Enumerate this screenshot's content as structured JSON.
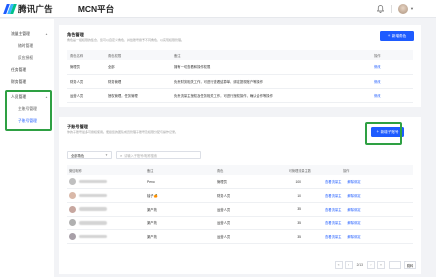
{
  "brand": {
    "name": "腾讯广告",
    "platform": "MCN平台",
    "colors": [
      "#1e5bff",
      "#3bb3ff",
      "#00c28a"
    ]
  },
  "sidebar": {
    "items": [
      {
        "label": "流量主管理",
        "type": "parent",
        "icon": "chevron-up-icon"
      },
      {
        "label": "随时管理",
        "type": "sub"
      },
      {
        "label": "反应授权",
        "type": "sub"
      },
      {
        "label": "任务管理",
        "type": "item"
      },
      {
        "label": "财务管理",
        "type": "item"
      },
      {
        "label": "人员管理",
        "type": "parent",
        "icon": "chevron-up-icon"
      },
      {
        "label": "主账号管理",
        "type": "sub"
      },
      {
        "label": "子账号管理",
        "type": "sub",
        "active": true
      }
    ]
  },
  "roles": {
    "title": "角色管理",
    "desc": "角色是一组权限的集合，您可以自定义角色，并给账号授予不同角色，以实现权限管理。",
    "add_button": "新增角色",
    "columns": [
      "角色名称",
      "角色权限",
      "备注",
      "操作"
    ],
    "rows": [
      {
        "name": "管理员",
        "perm": "全部",
        "note": "拥有一切查看和操作权限",
        "op": "修改"
      },
      {
        "name": "财务人员",
        "perm": "财务管理",
        "note": "负责财务相关工作，可进行查看结算单、绑定提现账户等操作",
        "op": "修改"
      },
      {
        "name": "运营人员",
        "perm": "授权管理，任务管理",
        "note": "负责流量主授权及任务相关工作，可进行授权操作，确认合作等操作",
        "op": "修改"
      }
    ]
  },
  "subaccounts": {
    "title": "子账号管理",
    "desc": "你的子账号最多可授权使用。便捷您的团队成员管理子账号及权限分配与操作记录。",
    "add_button": "新增子账号",
    "filter_select": "全部角色",
    "search_placeholder": "请输入子账号/昵称搜索",
    "columns": [
      "微信昵称",
      "备注",
      "角色",
      "可管理流量主数",
      "操作"
    ],
    "rows": [
      {
        "remark": "Peno",
        "role": "管理员",
        "count": "100",
        "op1": "查看流量主",
        "op2": "解除绑定"
      },
      {
        "remark": "柚子🍊",
        "role": "财务人员",
        "count": "10",
        "op1": "查看流量主",
        "op2": "解除绑定"
      },
      {
        "remark": "渠产苑",
        "role": "运营人员",
        "count": "35",
        "op1": "查看流量主",
        "op2": "解除绑定"
      },
      {
        "remark": "渠产苑",
        "role": "运营人员",
        "count": "35",
        "op1": "查看流量主",
        "op2": "解除绑定"
      },
      {
        "remark": "渠产苑",
        "role": "运营人员",
        "count": "35",
        "op1": "查看流量主",
        "op2": "解除绑定"
      }
    ],
    "pagination": {
      "page": "2/13",
      "go": "跳转"
    }
  }
}
